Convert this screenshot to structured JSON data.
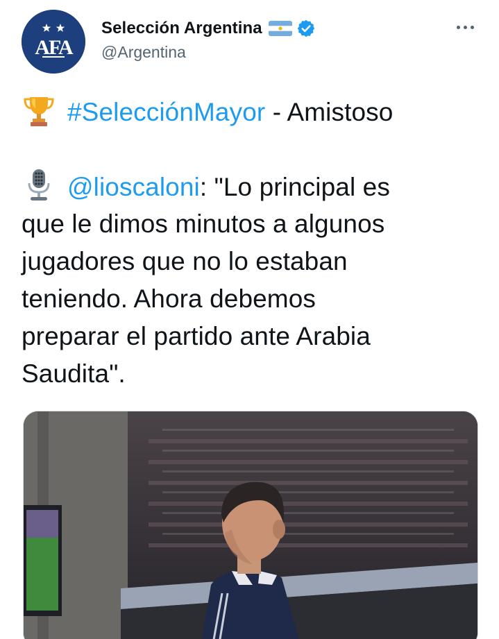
{
  "author": {
    "display_name": "Selección Argentina",
    "handle": "@Argentina",
    "avatar_logo_text": "AFA",
    "flag_icon": "argentina-flag-icon",
    "verified_icon": "verified-badge-icon"
  },
  "menu": {
    "more_icon": "more-options-icon"
  },
  "tweet": {
    "line1": {
      "emoji": "trophy-icon",
      "hashtag": "#SelecciónMayor",
      "rest": " - Amistoso"
    },
    "line2": {
      "emoji": "microphone-icon",
      "mention": "@lioscaloni",
      "rest": ": \"Lo principal es"
    },
    "line3": "que le dimos minutos a algunos",
    "line4": "jugadores que no lo estaban",
    "line5": "teniendo. Ahora debemos",
    "line6": "preparar el partido ante Arabia",
    "line7": "Saudita\"."
  },
  "media": {
    "kind": "photo",
    "subject": "coach-photo"
  },
  "colors": {
    "link": "#1d9bf0",
    "text": "#0f1419",
    "secondary": "#536471",
    "verified": "#1d9bf0",
    "afa_blue": "#1d3f7e"
  }
}
